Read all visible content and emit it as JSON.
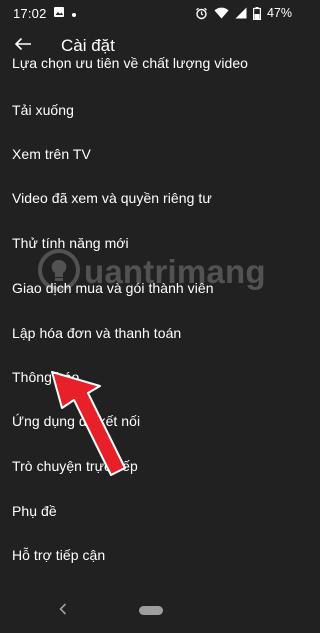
{
  "status_bar": {
    "time": "17:02",
    "battery": "47%",
    "icons": [
      "image-icon",
      "dot-icon",
      "alarm-icon",
      "wifi-icon",
      "signal-icon",
      "battery-icon"
    ]
  },
  "app_bar": {
    "title": "Cài đặt",
    "back_icon": "arrow-left-icon"
  },
  "settings": {
    "items": [
      {
        "label": "Lựa chọn ưu tiên về chất lượng video"
      },
      {
        "label": "Tải xuống"
      },
      {
        "label": "Xem trên TV"
      },
      {
        "label": "Video đã xem và quyền riêng tư"
      },
      {
        "label": "Thử tính năng mới"
      },
      {
        "label": "Giao dịch mua và gói thành viên"
      },
      {
        "label": "Lập hóa đơn và thanh toán"
      },
      {
        "label": "Thông báo"
      },
      {
        "label": "Ứng dụng đã kết nối"
      },
      {
        "label": "Trò chuyện trực tiếp"
      },
      {
        "label": "Phụ đề"
      },
      {
        "label": "Hỗ trợ tiếp cận"
      }
    ]
  },
  "watermark": {
    "text": "uantrimang"
  },
  "colors": {
    "background": "#212121",
    "text": "#ffffff",
    "arrow": "#e8202a"
  }
}
